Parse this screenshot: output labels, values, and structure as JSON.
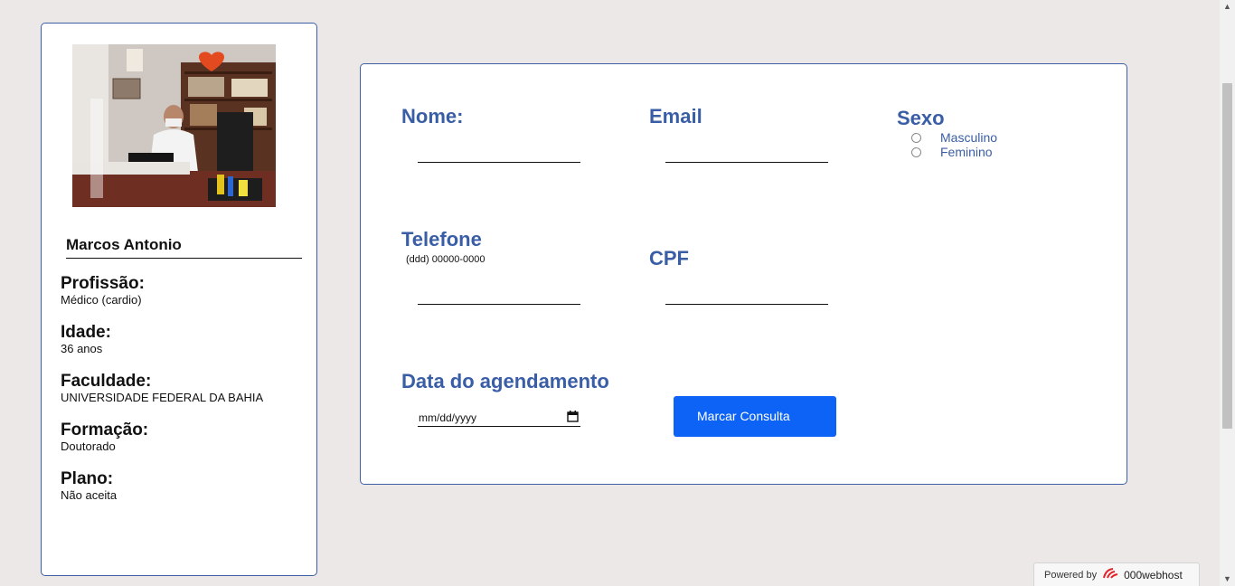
{
  "profile": {
    "name": "Marcos Antonio",
    "fields": [
      {
        "label": "Profissão:",
        "value": "Médico (cardio)"
      },
      {
        "label": "Idade:",
        "value": "36 anos"
      },
      {
        "label": "Faculdade:",
        "value": "UNIVERSIDADE FEDERAL DA BAHIA"
      },
      {
        "label": "Formação:",
        "value": "Doutorado"
      },
      {
        "label": "Plano:",
        "value": "Não aceita"
      }
    ]
  },
  "form": {
    "nome_label": "Nome:",
    "email_label": "Email",
    "sexo_label": "Sexo",
    "sexo_options": [
      "Masculino",
      "Feminino"
    ],
    "telefone_label": "Telefone",
    "telefone_hint": "(ddd) 00000-0000",
    "cpf_label": "CPF",
    "data_label": "Data do agendamento",
    "date_placeholder": "mm/dd/yyyy",
    "submit_label": "Marcar Consulta"
  },
  "footer": {
    "powered_by": "Powered by",
    "brand": "000webhost"
  },
  "colors": {
    "accent": "#3a5ea6",
    "button": "#0d63f6",
    "background": "#ece8e7"
  }
}
